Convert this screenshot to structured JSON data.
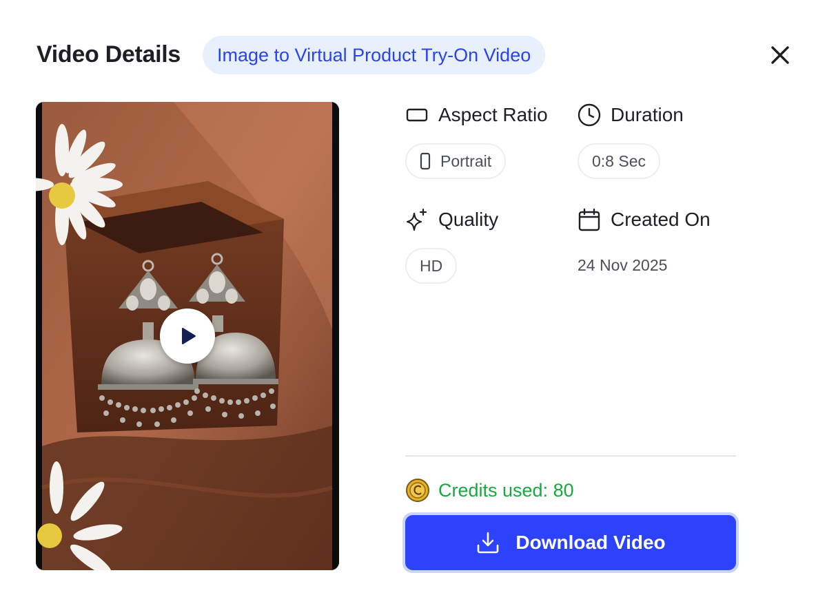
{
  "header": {
    "title": "Video Details",
    "badge": "Image to Virtual Product Try-On Video"
  },
  "video": {
    "thumbnail_description": "silver-jhumka-earrings",
    "play_icon": "play-icon"
  },
  "details": {
    "aspect_ratio": {
      "label": "Aspect Ratio",
      "value": "Portrait",
      "icon": "rectangle-icon",
      "value_icon": "phone-portrait-icon"
    },
    "duration": {
      "label": "Duration",
      "value": "0:8 Sec",
      "icon": "clock-icon"
    },
    "quality": {
      "label": "Quality",
      "value": "HD",
      "icon": "sparkles-icon"
    },
    "created_on": {
      "label": "Created On",
      "value": "24 Nov 2025",
      "icon": "calendar-icon"
    }
  },
  "credits": {
    "label": "Credits used: 80",
    "icon": "coin-icon"
  },
  "actions": {
    "download_label": "Download Video",
    "download_icon": "download-icon"
  },
  "colors": {
    "accent": "#2d43fb",
    "badge_bg": "#e8f0fd",
    "badge_text": "#2a42f0",
    "credits_green": "#17a83f"
  }
}
